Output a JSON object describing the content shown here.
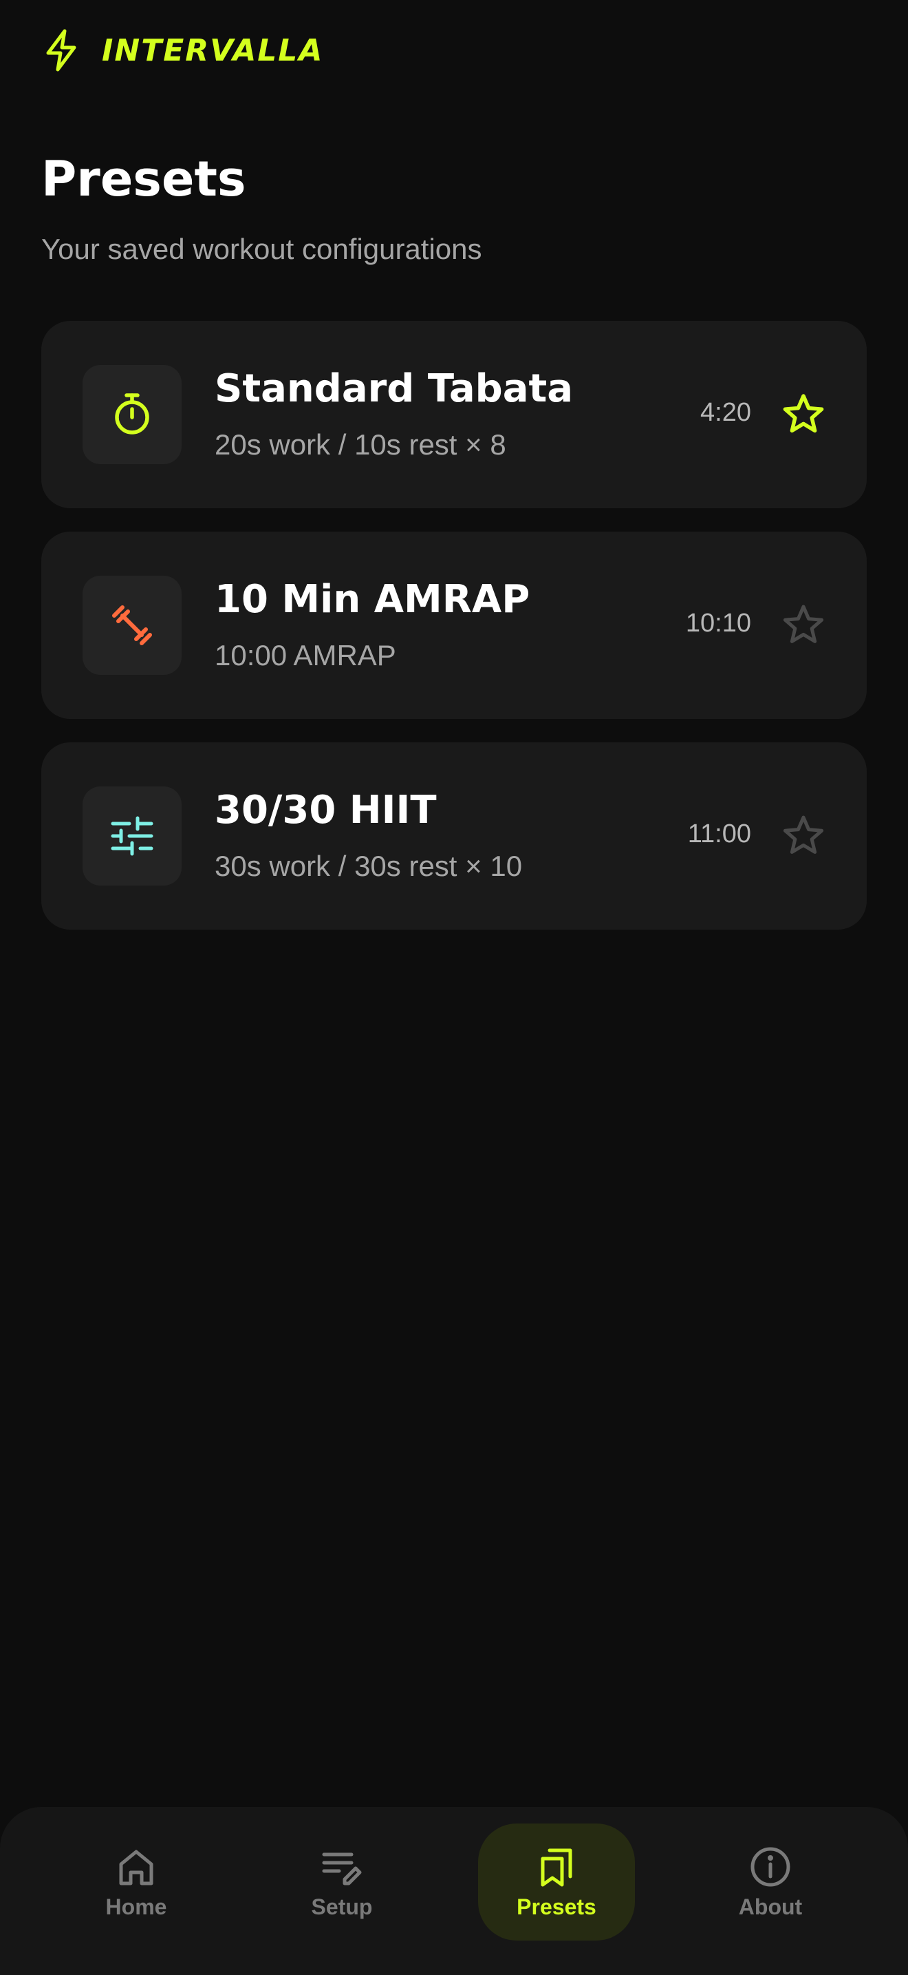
{
  "app": {
    "brand": "INTERVALLA",
    "accent_color": "#d4ff1e"
  },
  "page": {
    "title": "Presets",
    "subtitle": "Your saved workout configurations"
  },
  "presets": [
    {
      "name": "Standard Tabata",
      "description": "20s work / 10s rest × 8",
      "duration": "4:20",
      "icon": "stopwatch-icon",
      "icon_color": "#d4ff1e",
      "favorite": true
    },
    {
      "name": "10 Min AMRAP",
      "description": "10:00 AMRAP",
      "duration": "10:10",
      "icon": "dumbbell-icon",
      "icon_color": "#ff6b3d",
      "favorite": false
    },
    {
      "name": "30/30 HIIT",
      "description": "30s work / 30s rest × 10",
      "duration": "11:00",
      "icon": "sliders-icon",
      "icon_color": "#7ff0e6",
      "favorite": false
    }
  ],
  "nav": {
    "items": [
      {
        "label": "Home",
        "icon": "home-icon"
      },
      {
        "label": "Setup",
        "icon": "edit-list-icon"
      },
      {
        "label": "Presets",
        "icon": "bookmarks-icon",
        "active": true
      },
      {
        "label": "About",
        "icon": "info-icon"
      }
    ]
  }
}
